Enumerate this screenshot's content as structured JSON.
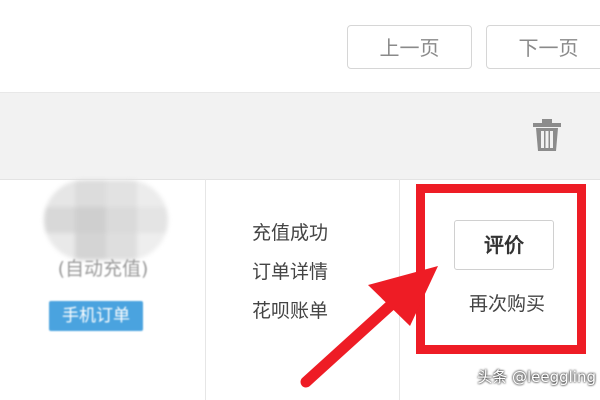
{
  "pagination": {
    "prev_label": "上一页",
    "next_label": "下一页"
  },
  "order_header": {
    "delete_icon": "trash-icon"
  },
  "order_item": {
    "product_name": "(自动充值)",
    "tag_label": "手机订单"
  },
  "order_links": {
    "status": "充值成功",
    "detail": "订单详情",
    "bill": "花呗账单"
  },
  "actions": {
    "review_label": "评价",
    "rebuy_label": "再次购买"
  },
  "annotation": {
    "box_color": "#ee1c25",
    "arrow_color": "#ee1c25"
  },
  "watermark": {
    "text": "头条 @leeggling"
  }
}
